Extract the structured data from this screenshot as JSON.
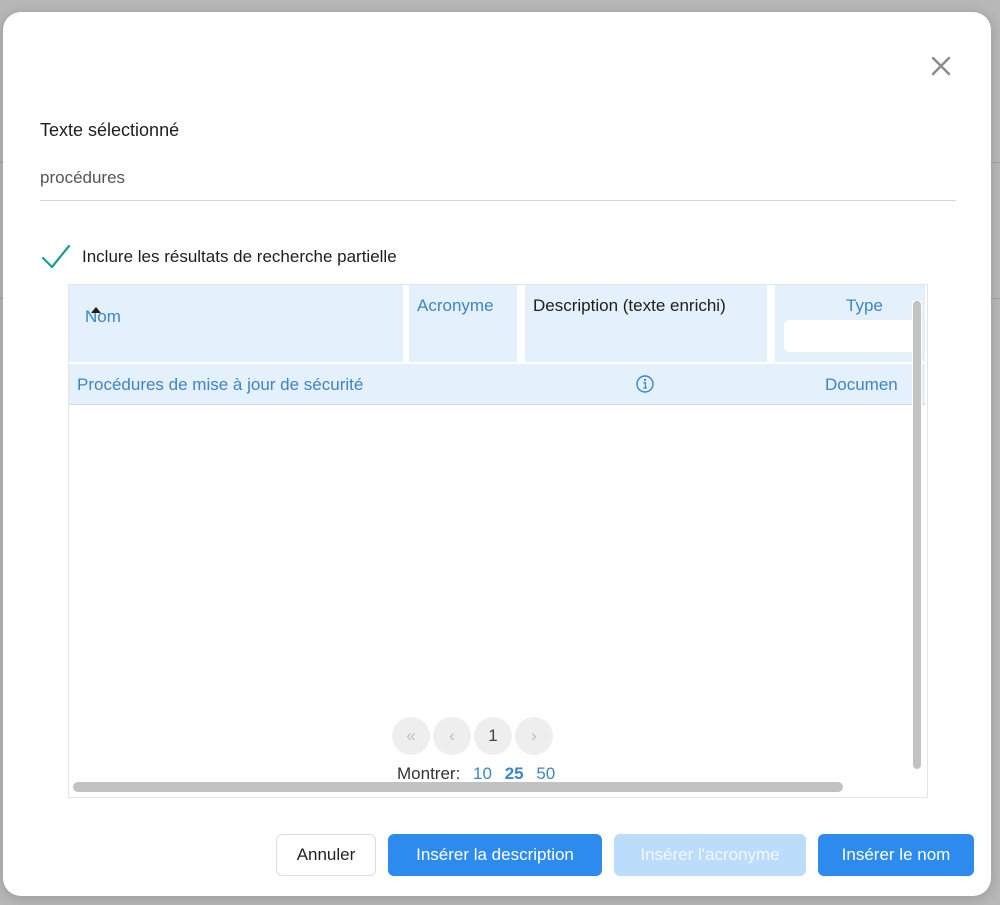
{
  "dialog": {
    "selected_text_label": "Texte sélectionné",
    "selected_text_value": "procédures",
    "partial_search_label": "Inclure les résultats de recherche partielle",
    "partial_search_checked": true
  },
  "grid": {
    "columns": {
      "name": "Nom",
      "acronym": "Acronyme",
      "description": "Description (texte enrichi)",
      "type": "Type"
    },
    "sort": {
      "column": "name",
      "direction": "ascending"
    },
    "rows": [
      {
        "name": "Procédures de mise à jour de sécurité",
        "acronym": "",
        "description_icon": "info-circle-icon",
        "type": "Documen"
      }
    ],
    "pagination": {
      "first_icon": "«",
      "prev_icon": "‹",
      "current_page": "1",
      "next_icon": "›",
      "show_label": "Montrer:",
      "options": [
        "10",
        "25",
        "50"
      ],
      "active_option": "25"
    }
  },
  "footer": {
    "cancel": "Annuler",
    "insert_description": "Insérer la description",
    "insert_acronym": "Insérer l'acronyme",
    "insert_name": "Insérer le nom"
  },
  "colors": {
    "primary": "#2d8bef",
    "primary_disabled": "#bcdcfb",
    "link": "#3d85c6",
    "header_bg": "#e4f0fc",
    "check": "#1a9f8c"
  }
}
